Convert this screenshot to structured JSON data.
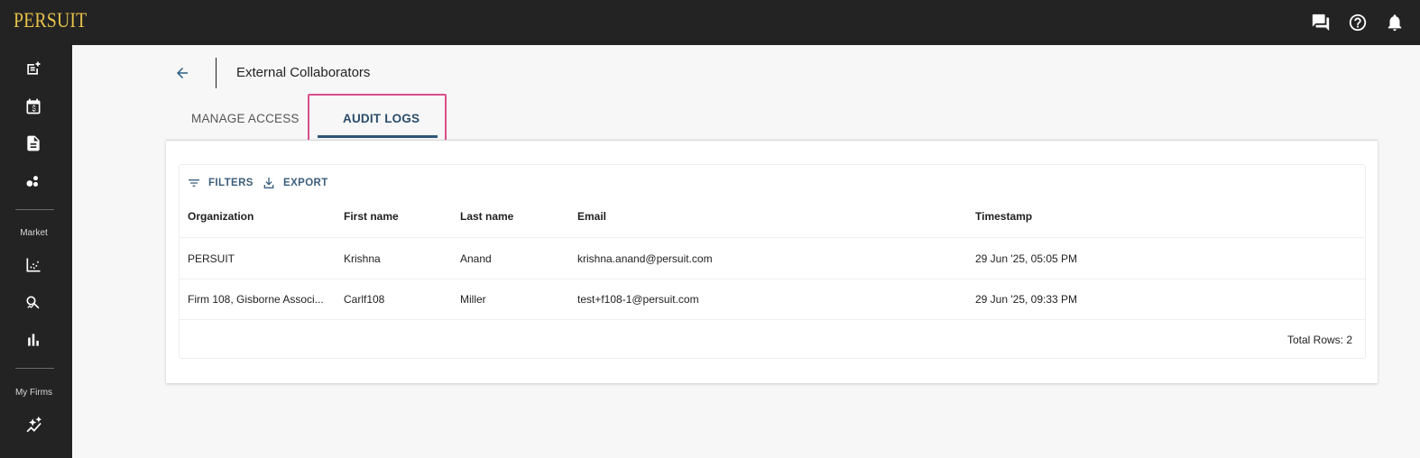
{
  "header": {
    "logo": "PERSUIT",
    "icons": [
      "chat-icon",
      "help-icon",
      "bell-icon"
    ]
  },
  "sidebar": {
    "icons_top": [
      "new-request-icon",
      "calendar-dollar-icon",
      "document-icon",
      "circles-icon"
    ],
    "market_label": "Market",
    "icons_market": [
      "scatter-chart-icon",
      "search-analytics-icon",
      "bar-chart-icon"
    ],
    "my_firms_label": "My Firms",
    "icons_firms": [
      "sparkle-trend-icon"
    ]
  },
  "page": {
    "title": "External Collaborators",
    "back_icon": "arrow-left-icon"
  },
  "tabs": [
    {
      "label": "MANAGE ACCESS",
      "active": false
    },
    {
      "label": "AUDIT LOGS",
      "active": true
    }
  ],
  "toolbar": {
    "filters_label": "FILTERS",
    "export_label": "EXPORT"
  },
  "table": {
    "columns": [
      "Organization",
      "First name",
      "Last name",
      "Email",
      "Timestamp"
    ],
    "rows": [
      [
        "PERSUIT",
        "Krishna",
        "Anand",
        "krishna.anand@persuit.com",
        "29 Jun '25, 05:05 PM"
      ],
      [
        "Firm 108, Gisborne Associ...",
        "Carlf108",
        "Miller",
        "test+f108-1@persuit.com",
        "29 Jun '25, 09:33 PM"
      ]
    ],
    "total_rows": "Total Rows: 2"
  },
  "colors": {
    "topbar": "#232323",
    "logo": "#e6c24a",
    "accent": "#2e5775",
    "highlight": "#d94f8b"
  }
}
